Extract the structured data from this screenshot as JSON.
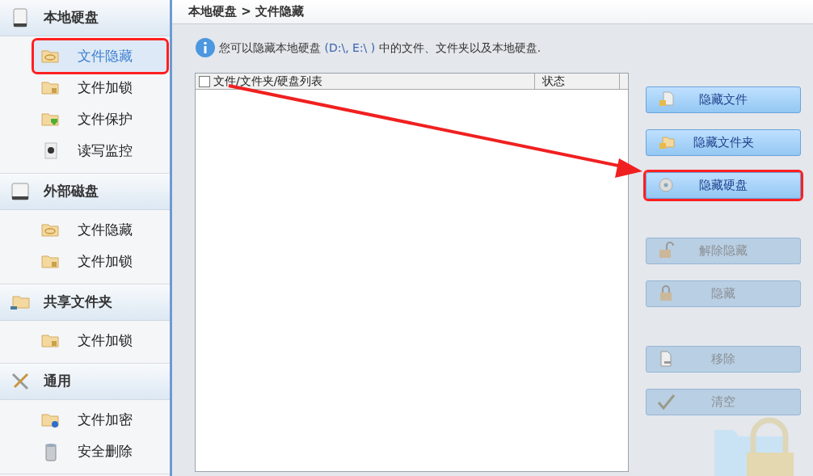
{
  "sidebar": {
    "sections": [
      {
        "title": "本地硬盘",
        "kind": "disk",
        "items": [
          {
            "label": "文件隐藏",
            "kind": "folder-eye",
            "selected": true,
            "highlighted": true
          },
          {
            "label": "文件加锁",
            "kind": "folder-lock",
            "selected": false,
            "highlighted": false
          },
          {
            "label": "文件保护",
            "kind": "folder-shield",
            "selected": false,
            "highlighted": false
          },
          {
            "label": "读写监控",
            "kind": "camera",
            "selected": false,
            "highlighted": false
          }
        ]
      },
      {
        "title": "外部磁盘",
        "kind": "usb",
        "items": [
          {
            "label": "文件隐藏",
            "kind": "folder-eye",
            "selected": false,
            "highlighted": false
          },
          {
            "label": "文件加锁",
            "kind": "folder-lock",
            "selected": false,
            "highlighted": false
          }
        ]
      },
      {
        "title": "共享文件夹",
        "kind": "share",
        "items": [
          {
            "label": "文件加锁",
            "kind": "folder-lock",
            "selected": false,
            "highlighted": false
          }
        ]
      },
      {
        "title": "通用",
        "kind": "tools",
        "items": [
          {
            "label": "文件加密",
            "kind": "folder-key",
            "selected": false,
            "highlighted": false
          },
          {
            "label": "安全删除",
            "kind": "trash",
            "selected": false,
            "highlighted": false
          }
        ]
      }
    ]
  },
  "breadcrumb": "本地硬盘 > 文件隐藏",
  "info": {
    "before": "您可以隐藏本地硬盘",
    "drives": "(D:\\, E:\\ )",
    "after": "中的文件、文件夹以及本地硬盘."
  },
  "table": {
    "select_all": {
      "checked": false
    },
    "columns": [
      {
        "label": "文件/文件夹/硬盘列表"
      },
      {
        "label": "状态"
      }
    ]
  },
  "button_groups": [
    [
      {
        "label": "隐藏文件",
        "kind": "file",
        "disabled": false,
        "highlighted": false
      },
      {
        "label": "隐藏文件夹",
        "kind": "folder",
        "disabled": false,
        "highlighted": false
      },
      {
        "label": "隐藏硬盘",
        "kind": "disc",
        "disabled": false,
        "highlighted": true
      }
    ],
    [
      {
        "label": "解除隐藏",
        "kind": "unlock",
        "disabled": true,
        "highlighted": false
      },
      {
        "label": "隐藏",
        "kind": "lock",
        "disabled": true,
        "highlighted": false
      }
    ],
    [
      {
        "label": "移除",
        "kind": "remove",
        "disabled": true,
        "highlighted": false
      },
      {
        "label": "清空",
        "kind": "check",
        "disabled": true,
        "highlighted": false
      }
    ]
  ]
}
